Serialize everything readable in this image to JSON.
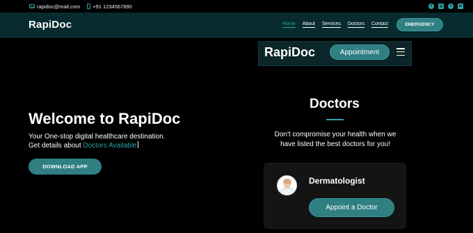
{
  "topbar": {
    "email": "rapidoc@mail.com",
    "phone": "+91 1234567890",
    "socials": [
      {
        "icon": "facebook-icon",
        "glyph": "f"
      },
      {
        "icon": "instagram-icon",
        "glyph": "◎"
      },
      {
        "icon": "twitter-icon",
        "glyph": "t"
      },
      {
        "icon": "linkedin-icon",
        "glyph": "in"
      }
    ]
  },
  "navbar": {
    "brand": "RapiDoc",
    "links": [
      "Home",
      "About",
      "Services",
      "Doctors",
      "Contact"
    ],
    "active_link": "Home",
    "emergency_label": "EMERGENCY"
  },
  "mobile_nav": {
    "brand": "RapiDoc",
    "appointment_label": "Appointment",
    "menu_icon": "hamburger-menu-icon"
  },
  "hero": {
    "title": "Welcome to RapiDoc",
    "line1": "Your One-stop digital healthcare destination.",
    "line2_prefix": "Get details about",
    "line2_accent": "Doctors Available",
    "download_label": "DOWNLOAD APP"
  },
  "doctors": {
    "title": "Doctors",
    "subtitle": "Don't compromise your health when we have listed the best doctors for you!",
    "card": {
      "specialty": "Dermatologist",
      "button_label": "Appoint a Doctor"
    }
  },
  "colors": {
    "accent": "#2fa1a7",
    "button": "#2f7f83",
    "navbar_bg": "#072b2f",
    "page_bg": "#000000",
    "card_bg": "#141414"
  }
}
